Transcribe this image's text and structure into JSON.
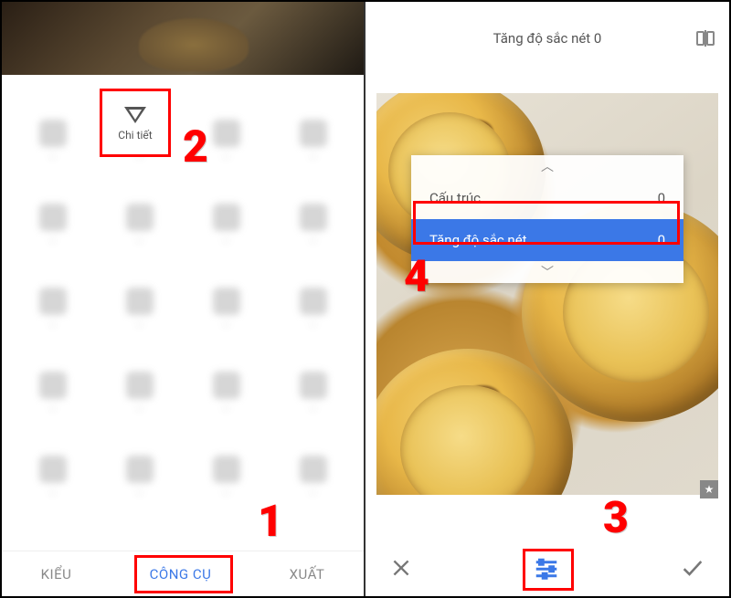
{
  "left": {
    "focused_tool_label": "Chi tiết",
    "tabs": {
      "styles": "KIỂU",
      "tools": "CÔNG CỤ",
      "export": "XUẤT"
    }
  },
  "right": {
    "title": "Tăng độ sắc nét 0",
    "menu": {
      "structure_label": "Cấu trúc",
      "structure_value": "0",
      "sharpen_label": "Tăng độ sắc nét",
      "sharpen_value": "0"
    }
  },
  "annotations": {
    "a1": "1",
    "a2": "2",
    "a3": "3",
    "a4": "4"
  }
}
